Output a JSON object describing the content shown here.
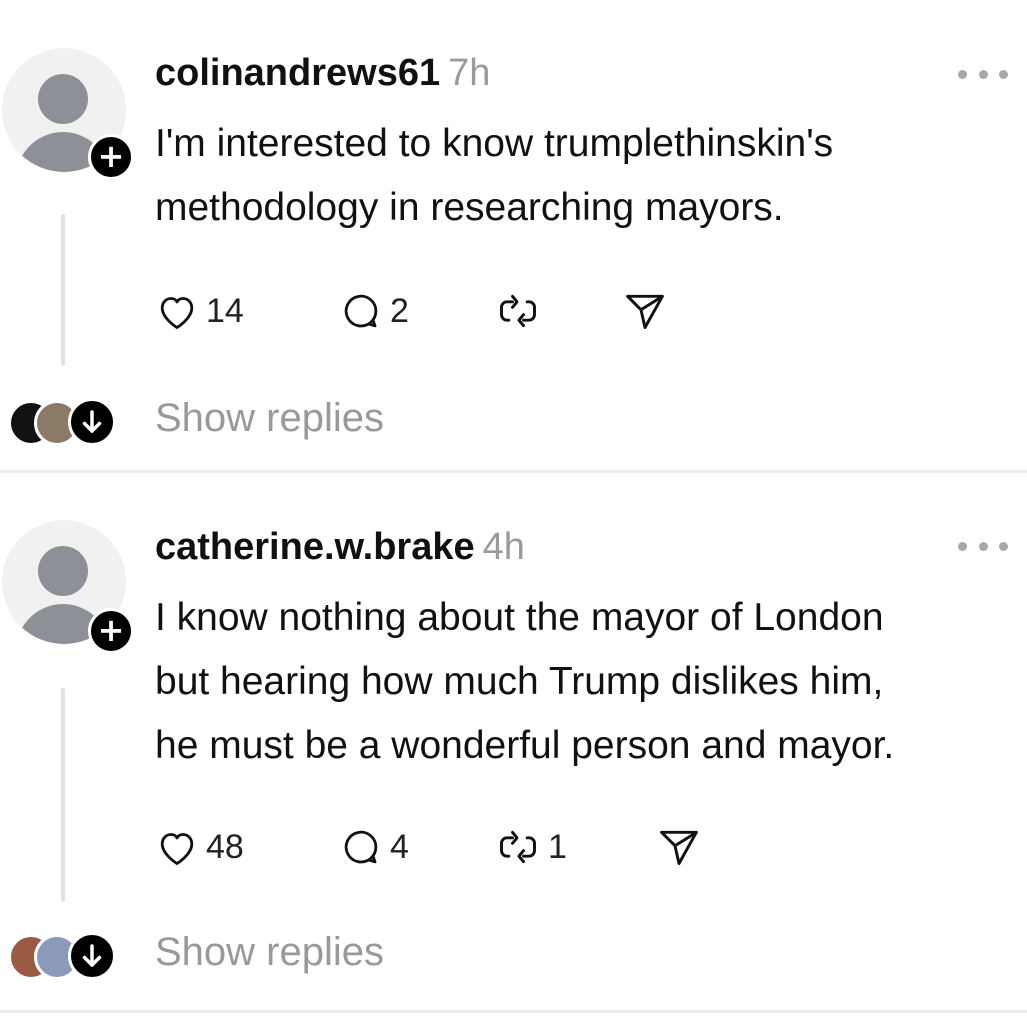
{
  "posts": [
    {
      "username": "colinandrews61",
      "time": "7h",
      "text_lines": [
        "I'm interested to know trumplethinskin's",
        "methodology in researching mayors."
      ],
      "likes": "14",
      "replies": "2",
      "reposts": "",
      "show_replies": "Show replies"
    },
    {
      "username": "catherine.w.brake",
      "time": "4h",
      "text_lines": [
        "I know nothing about the mayor of London",
        "but hearing how much Trump dislikes him,",
        "he must be a wonderful person and mayor."
      ],
      "likes": "48",
      "replies": "4",
      "reposts": "1",
      "show_replies": "Show replies"
    }
  ],
  "icons": {
    "follow": "plus-icon",
    "like": "heart-icon",
    "reply": "comment-icon",
    "repost": "repost-icon",
    "share": "send-icon",
    "more": "more-horizontal-icon",
    "replies": "arrow-down-icon"
  },
  "colors": {
    "text": "#111111",
    "muted": "#999999",
    "avatar_bg": "#f1f1f1",
    "avatar_fg": "#8d9096",
    "divider": "#ececec"
  }
}
